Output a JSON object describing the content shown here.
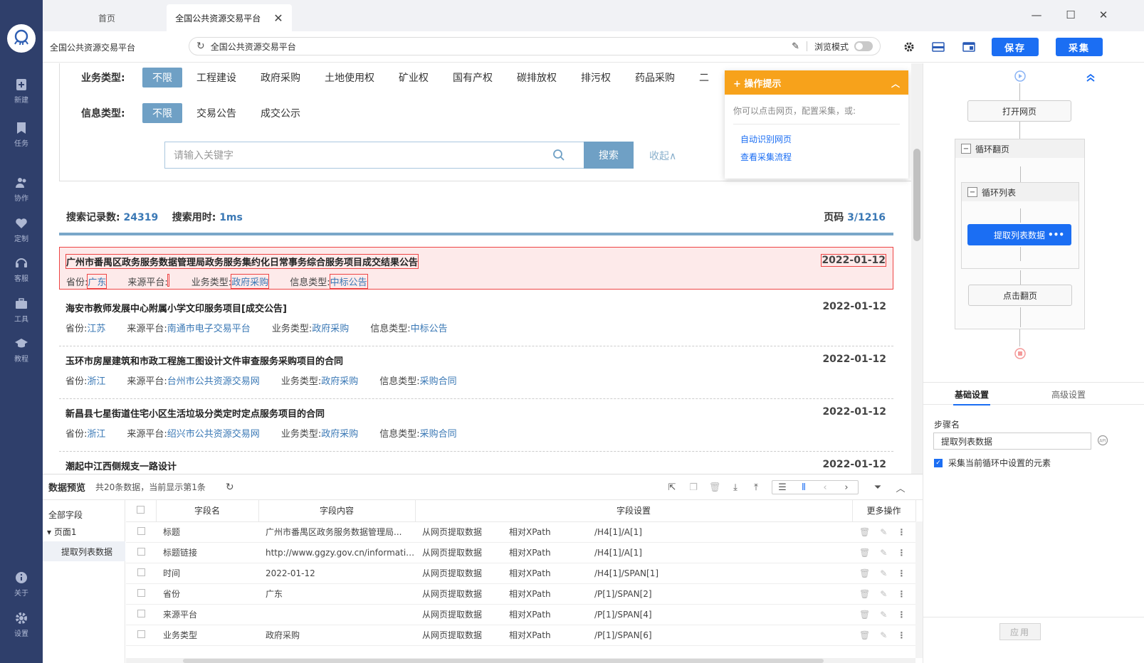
{
  "sidebar": {
    "items": [
      {
        "label": "新建",
        "icon": "plus-file-icon"
      },
      {
        "label": "任务",
        "icon": "bookmark-icon"
      },
      {
        "label": "协作",
        "icon": "users-icon"
      },
      {
        "label": "定制",
        "icon": "heart-icon"
      },
      {
        "label": "客服",
        "icon": "headset-icon"
      },
      {
        "label": "工具",
        "icon": "toolbox-icon"
      },
      {
        "label": "教程",
        "icon": "graduation-cap-icon"
      }
    ],
    "bottom": [
      {
        "label": "关于",
        "icon": "info-icon"
      },
      {
        "label": "设置",
        "icon": "gear-icon"
      }
    ]
  },
  "tabs": [
    {
      "label": "首页"
    },
    {
      "label": "全国公共资源交易平台"
    }
  ],
  "address": {
    "site_name": "全国公共资源交易平台",
    "url": "全国公共资源交易平台",
    "browse_mode_label": "浏览模式",
    "save_label": "保存",
    "collect_label": "采集"
  },
  "filters": {
    "business_label": "业务类型:",
    "business_options": [
      "不限",
      "工程建设",
      "政府采购",
      "土地使用权",
      "矿业权",
      "国有产权",
      "碳排放权",
      "排污权",
      "药品采购",
      "二"
    ],
    "info_label": "信息类型:",
    "info_options": [
      "不限",
      "交易公告",
      "成交公示"
    ],
    "search_placeholder": "请输入关键字",
    "search_button": "搜索",
    "collapse": "收起∧"
  },
  "stats": {
    "records_label": "搜索记录数:",
    "records": "24319",
    "time_label": "搜索用时:",
    "time": "1ms",
    "page_label": "页码",
    "page": "3/1216"
  },
  "results": [
    {
      "title": "广州市番禺区政务服务数据管理局政务服务集约化日常事务综合服务项目成交结果公告",
      "date": "2022-01-12",
      "province": "广东",
      "platform": "",
      "business": "政府采购",
      "info": "中标公告"
    },
    {
      "title": "海安市教师发展中心附属小学文印服务项目[成交公告]",
      "date": "2022-01-12",
      "province": "江苏",
      "platform": "南通市电子交易平台",
      "business": "政府采购",
      "info": "中标公告"
    },
    {
      "title": "玉环市房屋建筑和市政工程施工图设计文件审查服务采购项目的合同",
      "date": "2022-01-12",
      "province": "浙江",
      "platform": "台州市公共资源交易网",
      "business": "政府采购",
      "info": "采购合同"
    },
    {
      "title": "新昌县七星街道住宅小区生活垃圾分类定时定点服务项目的合同",
      "date": "2022-01-12",
      "province": "浙江",
      "platform": "绍兴市公共资源交易网",
      "business": "政府采购",
      "info": "采购合同"
    },
    {
      "title": "潮起中江西侧规支一路设计",
      "date": "2022-01-12"
    }
  ],
  "meta_labels": {
    "province": "省份:",
    "platform": "来源平台:",
    "business": "业务类型:",
    "info": "信息类型:"
  },
  "hint": {
    "title": "+ 操作提示",
    "desc": "你可以点击网页，配置采集，或:",
    "link1": "自动识别网页",
    "link2": "查看采集流程"
  },
  "flow": {
    "open_page": "打开网页",
    "loop_page": "循环翻页",
    "loop_list": "循环列表",
    "extract": "提取列表数据",
    "extract_more": "•••",
    "click_page": "点击翻页"
  },
  "settings": {
    "tab_basic": "基础设置",
    "tab_advanced": "高级设置",
    "step_name_label": "步骤名",
    "step_name_value": "提取列表数据",
    "check_label": "采集当前循环中设置的元素",
    "apply": "应用"
  },
  "preview": {
    "title": "数据预览",
    "count": "共20条数据，当前显示第1条",
    "tree_all": "全部字段",
    "tree_page": "页面1",
    "tree_item": "提取列表数据",
    "headers": {
      "name": "字段名",
      "content": "字段内容",
      "setting": "字段设置",
      "more": "更多操作"
    },
    "rows": [
      {
        "name": "标题",
        "content": "广州市番禺区政务服务数据管理局...",
        "source": "从网页提取数据",
        "xtype": "相对XPath",
        "xpath": "/H4[1]/A[1]"
      },
      {
        "name": "标题链接",
        "content": "http://www.ggzy.gov.cn/informatio...",
        "source": "从网页提取数据",
        "xtype": "相对XPath",
        "xpath": "/H4[1]/A[1]"
      },
      {
        "name": "时间",
        "content": "2022-01-12",
        "source": "从网页提取数据",
        "xtype": "相对XPath",
        "xpath": "/H4[1]/SPAN[1]"
      },
      {
        "name": "省份",
        "content": "广东",
        "source": "从网页提取数据",
        "xtype": "相对XPath",
        "xpath": "/P[1]/SPAN[2]"
      },
      {
        "name": "来源平台",
        "content": "",
        "source": "从网页提取数据",
        "xtype": "相对XPath",
        "xpath": "/P[1]/SPAN[4]"
      },
      {
        "name": "业务类型",
        "content": "政府采购",
        "source": "从网页提取数据",
        "xtype": "相对XPath",
        "xpath": "/P[1]/SPAN[6]"
      }
    ]
  },
  "colors": {
    "sidebar": "#2f3f6b",
    "primary": "#1b6ef3",
    "hint_orange": "#f7a21b",
    "chip_blue": "#6fa0c5",
    "link_blue": "#3a78b5",
    "selected_red": "#e44"
  }
}
